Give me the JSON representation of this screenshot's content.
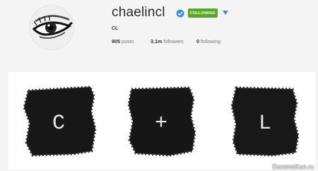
{
  "profile": {
    "username": "chaelincl",
    "full_name": "CL",
    "follow_button_label": "FOLLOWING",
    "verified_icon": "verified-badge-icon",
    "dropdown_icon": "caret-down-icon",
    "avatar_icon": "eye-closeup-image"
  },
  "stats": {
    "posts_count": "905",
    "posts_label": "posts",
    "followers_count": "3.1m",
    "followers_label": "followers",
    "following_count": "0",
    "following_label": "following"
  },
  "posts": [
    {
      "glyph": "C"
    },
    {
      "glyph": "+"
    },
    {
      "glyph": "L"
    }
  ],
  "watermark": "DoramaKun.ru",
  "colors": {
    "follow_green": "#5aa52b",
    "verified_blue": "#3a8fd9",
    "dropdown_blue": "#3a8fd9",
    "page_bg": "#f4f4f4"
  }
}
